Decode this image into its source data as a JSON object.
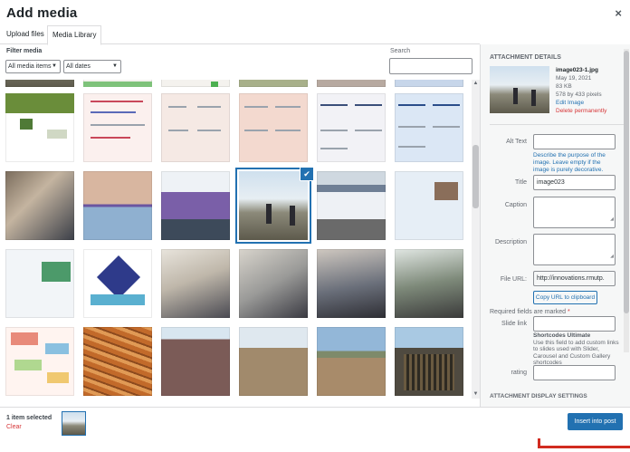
{
  "header": {
    "title": "Add media",
    "close_glyph": "×"
  },
  "tabs": [
    {
      "label": "Upload files"
    },
    {
      "label": "Media Library"
    }
  ],
  "filter": {
    "label": "Filter media",
    "type_select": "All media items",
    "date_select": "All dates",
    "search_label": "Search",
    "search_value": ""
  },
  "grid": {
    "item_count_visible": 30,
    "selected_item": "image023-1.jpg"
  },
  "details": {
    "heading": "ATTACHMENT DETAILS",
    "filename": "image023-1.jpg",
    "date": "May 19, 2021",
    "size": "83 KB",
    "dimensions": "578 by 433 pixels",
    "edit_link": "Edit Image",
    "delete_link": "Delete permanently",
    "alt_text_label": "Alt Text",
    "alt_text_value": "",
    "alt_text_help": "Describe the purpose of the image. Leave empty if the image is purely decorative.",
    "title_label": "Title",
    "title_value": "image023",
    "caption_label": "Caption",
    "description_label": "Description",
    "file_url_label": "File URL:",
    "file_url_value": "http://innovations.rmutp.",
    "copy_button": "Copy URL to clipboard",
    "required_note": "Required fields are marked",
    "required_star": "*",
    "slide_link_label": "Slide link",
    "slide_help_title": "Shortcodes Ultimate",
    "slide_help_text": "Use this field to add custom links to slides used with Slider, Carousel and Custom Gallery shortcodes",
    "rating_label": "rating",
    "display_settings_heading": "ATTACHMENT DISPLAY SETTINGS"
  },
  "footer": {
    "selected_count": "1 item selected",
    "clear": "Clear",
    "insert_button": "Insert into post"
  },
  "colors": {
    "accent": "#2271b1",
    "danger": "#d63638",
    "annotation": "#d12b20"
  },
  "icons": {
    "close": "close-icon",
    "check": "checkmark-icon",
    "caret": "chevron-down-icon"
  }
}
